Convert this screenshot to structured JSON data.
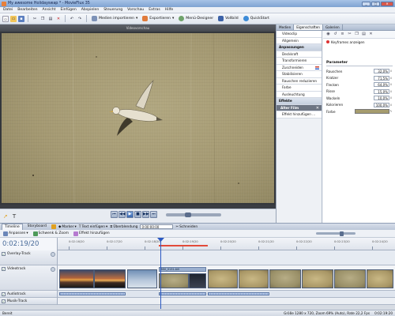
{
  "window": {
    "title": "My awesome Holidayswap * - MovieFlux 35",
    "buttons": [
      "_",
      "□",
      "✕"
    ]
  },
  "menu": [
    "Datei",
    "Bearbeiten",
    "Ansicht",
    "Einfügen",
    "Abspielen",
    "Steuerung",
    "Vorschau",
    "Extras",
    "Hilfe"
  ],
  "toolbar": {
    "media_import": "Medien importieren",
    "export": "Exportieren",
    "menu_designer": "Menü-Designer",
    "fullscreen": "Vollbild",
    "quickstart": "QuickStart"
  },
  "preview": {
    "header": "Videovorschau"
  },
  "panel": {
    "tabs": [
      "Medien",
      "Eigenschaften",
      "Galerien"
    ],
    "active_tab": "Eigenschaften",
    "effects": [
      {
        "label": "Videoclip",
        "kind": "indent"
      },
      {
        "label": "Allgemein",
        "kind": "indent"
      },
      {
        "label": "Anpassungen",
        "kind": "group"
      },
      {
        "label": "Deckkraft",
        "kind": "indent"
      },
      {
        "label": "Transformieren",
        "kind": "indent"
      },
      {
        "label": "Zuschneiden",
        "kind": "indent"
      },
      {
        "label": "Stabilisieren",
        "kind": "indent"
      },
      {
        "label": "Rauschen reduzieren",
        "kind": "indent"
      },
      {
        "label": "Farbe",
        "kind": "indent"
      },
      {
        "label": "Ausleuchtung",
        "kind": "indent"
      },
      {
        "label": "Effekte",
        "kind": "group"
      },
      {
        "label": "Alter Film",
        "kind": "dark"
      },
      {
        "label": "Effekt hinzufügen ...",
        "kind": "indent"
      }
    ],
    "keyframes_label": "Keyframes anzeigen",
    "params_title": "Parameter",
    "params": [
      {
        "label": "Rauschen",
        "value": "32,0%"
      },
      {
        "label": "Kratzer",
        "value": "71,5%"
      },
      {
        "label": "Flecken",
        "value": "64,0%"
      },
      {
        "label": "Risse",
        "value": "15,0%"
      },
      {
        "label": "Wackeln",
        "value": "10,0%"
      },
      {
        "label": "Kolorieren",
        "value": "100,0%"
      }
    ],
    "color_label": "Farbe",
    "color_value": "#a69c6e"
  },
  "timeline": {
    "tabs": [
      "Timeline",
      "Storyboard"
    ],
    "active_tab": "Timeline",
    "marker": "Marker",
    "text_insert": "Text einfügen",
    "transition": "Überblendung",
    "transition_time": "0:00:00:00",
    "cut": "Schneiden",
    "adjust": "Anpassen",
    "pan_zoom": "Schwenk & Zoom",
    "add_effect": "Effekt hinzufügen",
    "timecode": "0:02:19/20",
    "ruler_labels": [
      "0:02:16/20",
      "0:02:17/20",
      "0:02:18/20",
      "0:02:19/20",
      "0:02:20/20",
      "0:02:21/20",
      "0:02:22/20",
      "0:02:23/20",
      "0:02:24/20"
    ],
    "tracks": [
      "Overlay-Track",
      "Videotrack",
      "Audiotrack",
      "Musik-Track"
    ],
    "clip_header": "MVI_0131.AVI",
    "audio_labels": [
      "MVI_0131.AVI",
      "MVI_0131.AVI",
      "MVI_0131.AVI"
    ]
  },
  "status": {
    "left": "Bereit",
    "right": "Größe 1280 x 720, Zoom 69% (Auto), Rate 22,2 Fps",
    "time": "0:02:19:20"
  }
}
